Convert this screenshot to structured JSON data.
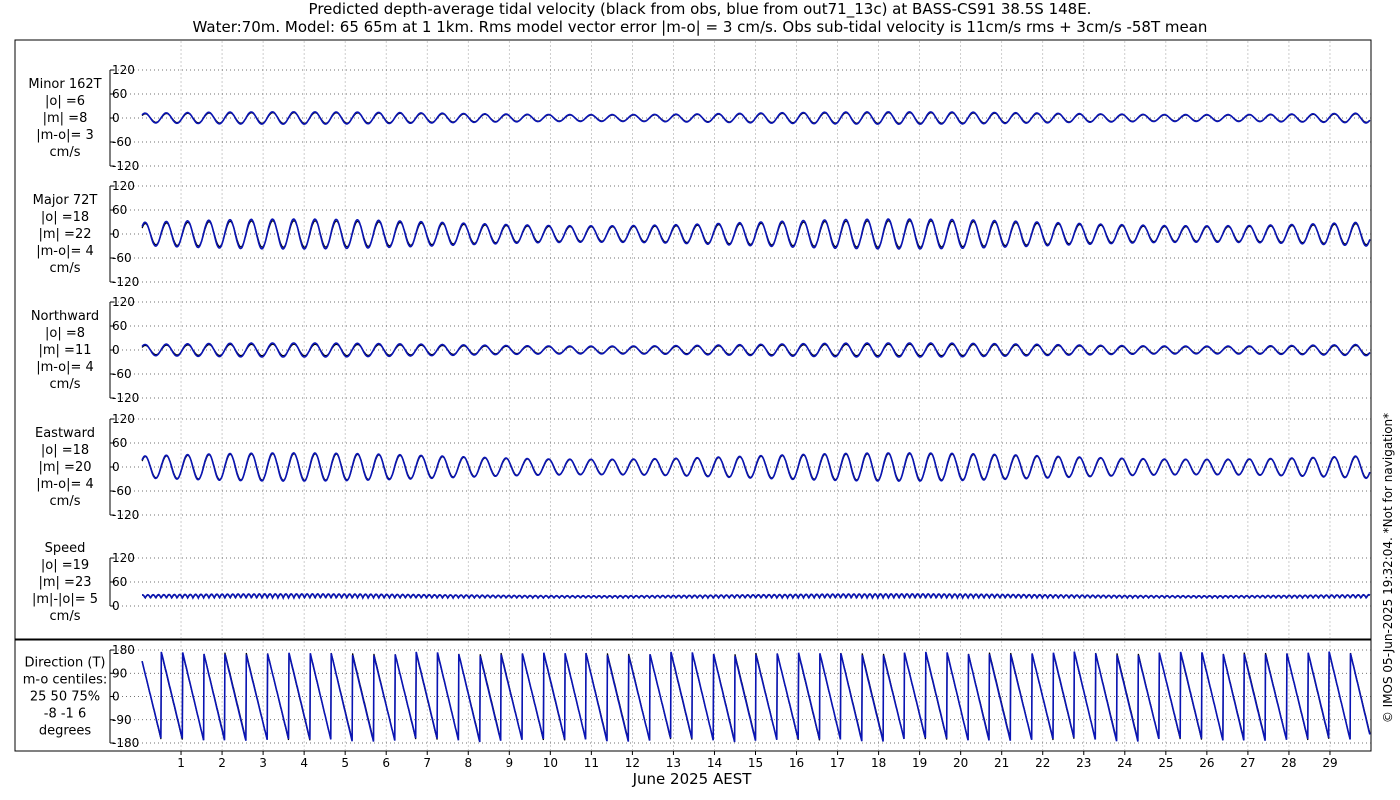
{
  "header": {
    "title_line1": "Predicted depth-average tidal velocity (black from obs, blue from out71_13c) at BASS-CS91 38.5S 148E.",
    "title_line2": "Water:70m. Model: 65 65m at 1 1km. Rms model vector error |m-o| = 3 cm/s. Obs sub-tidal velocity is 11cm/s rms + 3cm/s -58T mean"
  },
  "footer": {
    "xlabel": "June 2025 AEST",
    "copyright": "© IMOS 05-Jun-2025 19:32:04. *Not for navigation*"
  },
  "colors": {
    "obs": "#000000",
    "model": "#0a14b4",
    "grid": "#b8b8b8",
    "frame": "#000000"
  },
  "chart_data": {
    "type": "line",
    "x_axis": {
      "label": "June 2025 AEST",
      "ticks": [
        1,
        2,
        3,
        4,
        5,
        6,
        7,
        8,
        9,
        10,
        11,
        12,
        13,
        14,
        15,
        16,
        17,
        18,
        19,
        20,
        21,
        22,
        23,
        24,
        25,
        26,
        27,
        28,
        29
      ],
      "range_days": [
        0.0,
        30.0
      ],
      "grid": true
    },
    "series_legend": {
      "obs": "black from obs",
      "model": "blue from out71_13c"
    },
    "panels": [
      {
        "id": "minor",
        "labels": [
          "Minor 162T",
          "|o| =6",
          "|m| =8",
          "|m-o|= 3",
          "cm/s"
        ],
        "ticks": [
          "120",
          "60",
          "0",
          "-60",
          "-120"
        ],
        "tick_values": [
          120,
          60,
          0,
          -60,
          -120
        ],
        "ylim": [
          -120,
          120
        ],
        "amp_obs": 12,
        "amp_model": 14,
        "period_hours": 12.42,
        "mean": 0
      },
      {
        "id": "major",
        "labels": [
          "Major 72T",
          "|o| =18",
          "|m| =22",
          "|m-o|= 4",
          "cm/s"
        ],
        "ticks": [
          "120",
          "60",
          "0",
          "-60",
          "-120"
        ],
        "tick_values": [
          120,
          60,
          0,
          -60,
          -120
        ],
        "ylim": [
          -120,
          120
        ],
        "amp_obs": 30,
        "amp_model": 34,
        "period_hours": 12.42,
        "mean": 0
      },
      {
        "id": "northward",
        "labels": [
          "Northward",
          "|o| =8",
          "|m| =11",
          "|m-o|= 4",
          "cm/s"
        ],
        "ticks": [
          "120",
          "60",
          "0",
          "-60",
          "-120"
        ],
        "tick_values": [
          120,
          60,
          0,
          -60,
          -120
        ],
        "ylim": [
          -120,
          120
        ],
        "amp_obs": 13,
        "amp_model": 16,
        "period_hours": 12.42,
        "mean": 0
      },
      {
        "id": "eastward",
        "labels": [
          "Eastward",
          "|o| =18",
          "|m| =20",
          "|m-o|= 4",
          "cm/s"
        ],
        "ticks": [
          "120",
          "60",
          "0",
          "-60",
          "-120"
        ],
        "tick_values": [
          120,
          60,
          0,
          -60,
          -120
        ],
        "ylim": [
          -120,
          120
        ],
        "amp_obs": 30,
        "amp_model": 32,
        "period_hours": 12.42,
        "mean": 0
      },
      {
        "id": "speed",
        "labels": [
          "Speed",
          "|o| =19",
          "|m| =23",
          "|m|-|o|= 5",
          "cm/s"
        ],
        "ticks": [
          "120",
          "60",
          "0"
        ],
        "tick_values": [
          120,
          60,
          0
        ],
        "ylim": [
          0,
          120
        ],
        "amp_obs": 10,
        "amp_model": 11,
        "period_hours": 6.21,
        "mean": 20
      },
      {
        "id": "direction",
        "labels": [
          "Direction (T)",
          "m-o centiles:",
          "25  50  75%",
          "-8 -1  6",
          "degrees"
        ],
        "ticks": [
          "180",
          "90",
          "0",
          "-90",
          "-180"
        ],
        "tick_values": [
          180,
          90,
          0,
          -90,
          -180
        ],
        "ylim": [
          -180,
          180
        ],
        "period_hours": 12.42,
        "offset_deg": -1
      }
    ]
  }
}
